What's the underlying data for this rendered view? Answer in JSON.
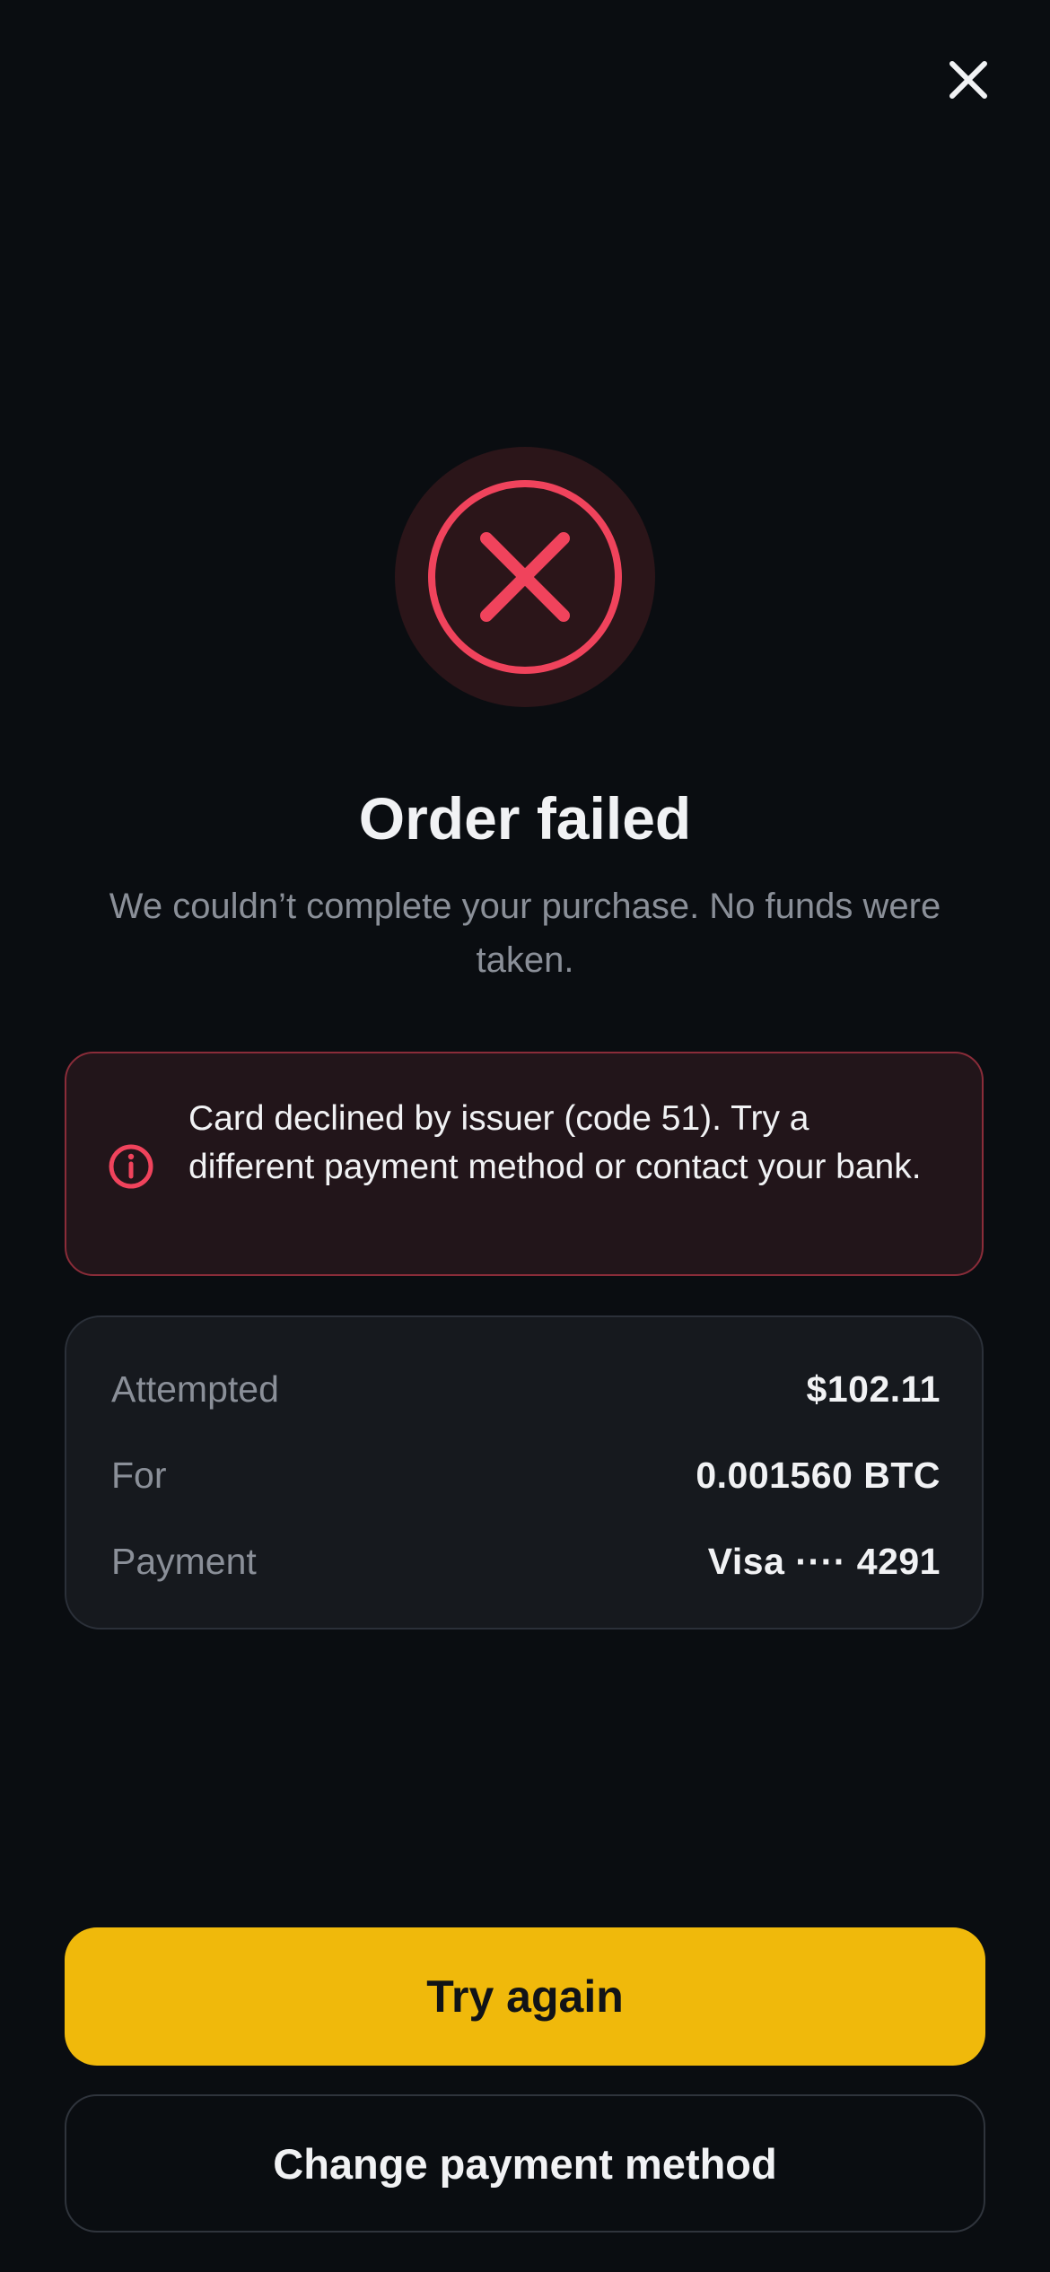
{
  "header": {
    "close_icon": "close-icon"
  },
  "status": {
    "icon": "error-x-circle-icon",
    "title": "Order failed",
    "subtitle": "We couldn’t complete your purchase. No funds were taken."
  },
  "alert": {
    "icon": "info-circle-icon",
    "message": "Card declined by issuer (code 51). Try a different payment method or contact your bank."
  },
  "summary": {
    "rows": [
      {
        "label": "Attempted",
        "value": "$102.11"
      },
      {
        "label": "For",
        "value": "0.001560 BTC"
      },
      {
        "label": "Payment",
        "value": "Visa ···· 4291"
      }
    ]
  },
  "actions": {
    "primary_label": "Try again",
    "secondary_label": "Change payment method"
  },
  "colors": {
    "background": "#0a0d11",
    "error": "#f0435c",
    "accent": "#f0b90b"
  }
}
